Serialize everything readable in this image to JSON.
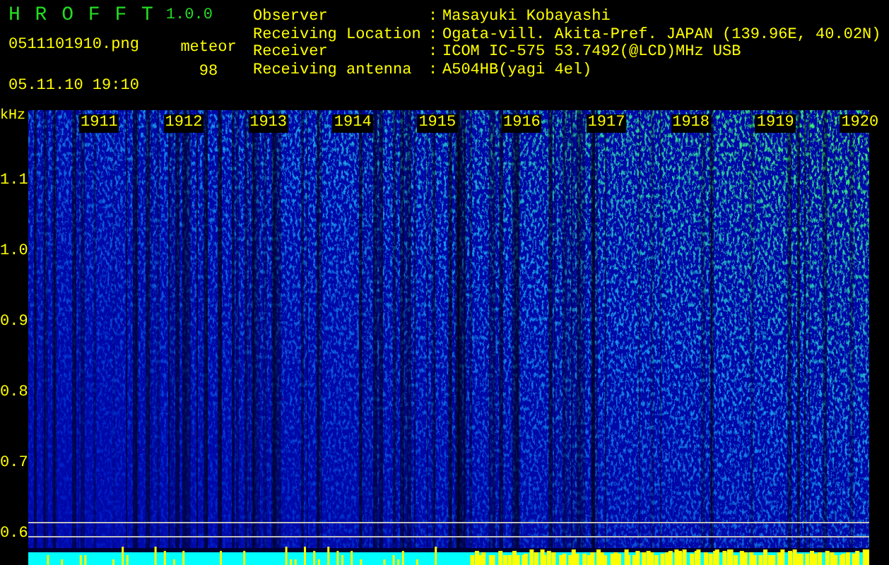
{
  "app": {
    "title": "H R O F F T",
    "version": "1.0.0"
  },
  "file_name": "0511101910.png",
  "date_time": "05.11.10 19:10",
  "meteor": {
    "label": "meteor",
    "count": "98"
  },
  "info": [
    {
      "label": "Observer",
      "separator": ":",
      "value": "Masayuki Kobayashi"
    },
    {
      "label": "Receiving Location",
      "separator": ":",
      "value": "Ogata-vill. Akita-Pref. JAPAN (139.96E, 40.02N)"
    },
    {
      "label": "Receiver",
      "separator": ":",
      "value": "ICOM IC-575 53.7492(@LCD)MHz USB"
    },
    {
      "label": "Receiving antenna",
      "separator": ":",
      "value": "A504HB(yagi 4el)"
    }
  ],
  "spectrogram": {
    "y_unit": "kHz",
    "y_labels": [
      "1.1",
      "1.0",
      "0.9",
      "0.8",
      "0.7",
      "0.6"
    ],
    "time_labels": [
      "1911",
      "1912",
      "1913",
      "1914",
      "1915",
      "1916",
      "1917",
      "1918",
      "1919",
      "1920"
    ]
  }
}
